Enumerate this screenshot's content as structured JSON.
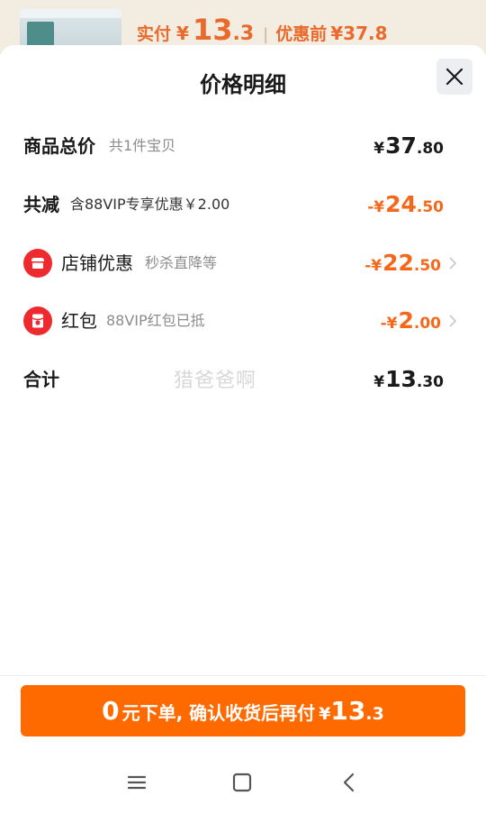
{
  "top_bar": {
    "pay_label": "实付",
    "yen": "¥",
    "price_int": "13",
    "price_dec": ".3",
    "separator": "|",
    "before_label": "优惠前",
    "before_value": "¥37.8"
  },
  "sheet": {
    "title": "价格明细",
    "close_icon": "close-icon"
  },
  "rows": {
    "total": {
      "label": "商品总价",
      "sub": "共1件宝贝",
      "yen": "¥",
      "int": "37",
      "dec": ".80"
    },
    "reduce": {
      "label": "共减",
      "sub": "含88VIP专享优惠￥2.00",
      "yen": "-¥",
      "int": "24",
      "dec": ".50"
    },
    "shop": {
      "icon": "shop-icon",
      "label": "店铺优惠",
      "sub": "秒杀直降等",
      "yen": "-¥",
      "int": "22",
      "dec": ".50"
    },
    "redpacket": {
      "icon": "red-packet-icon",
      "label": "红包",
      "sub": "88VIP红包已抵",
      "yen": "-¥",
      "int": "2",
      "dec": ".00"
    },
    "sum": {
      "label": "合计",
      "yen": "¥",
      "int": "13",
      "dec": ".30"
    }
  },
  "watermark": "猎爸爸啊",
  "pay_button": {
    "zero": "0",
    "text": "元下单, 确认收货后再付",
    "yen": "¥",
    "int": "13",
    "dec": ".3"
  },
  "nav": {
    "menu_icon": "menu-icon",
    "home_icon": "home-icon",
    "back_icon": "back-icon"
  },
  "colors": {
    "accent": "#ff6a00",
    "discount": "#f5681b",
    "icon_red": "#ee2a2e"
  }
}
